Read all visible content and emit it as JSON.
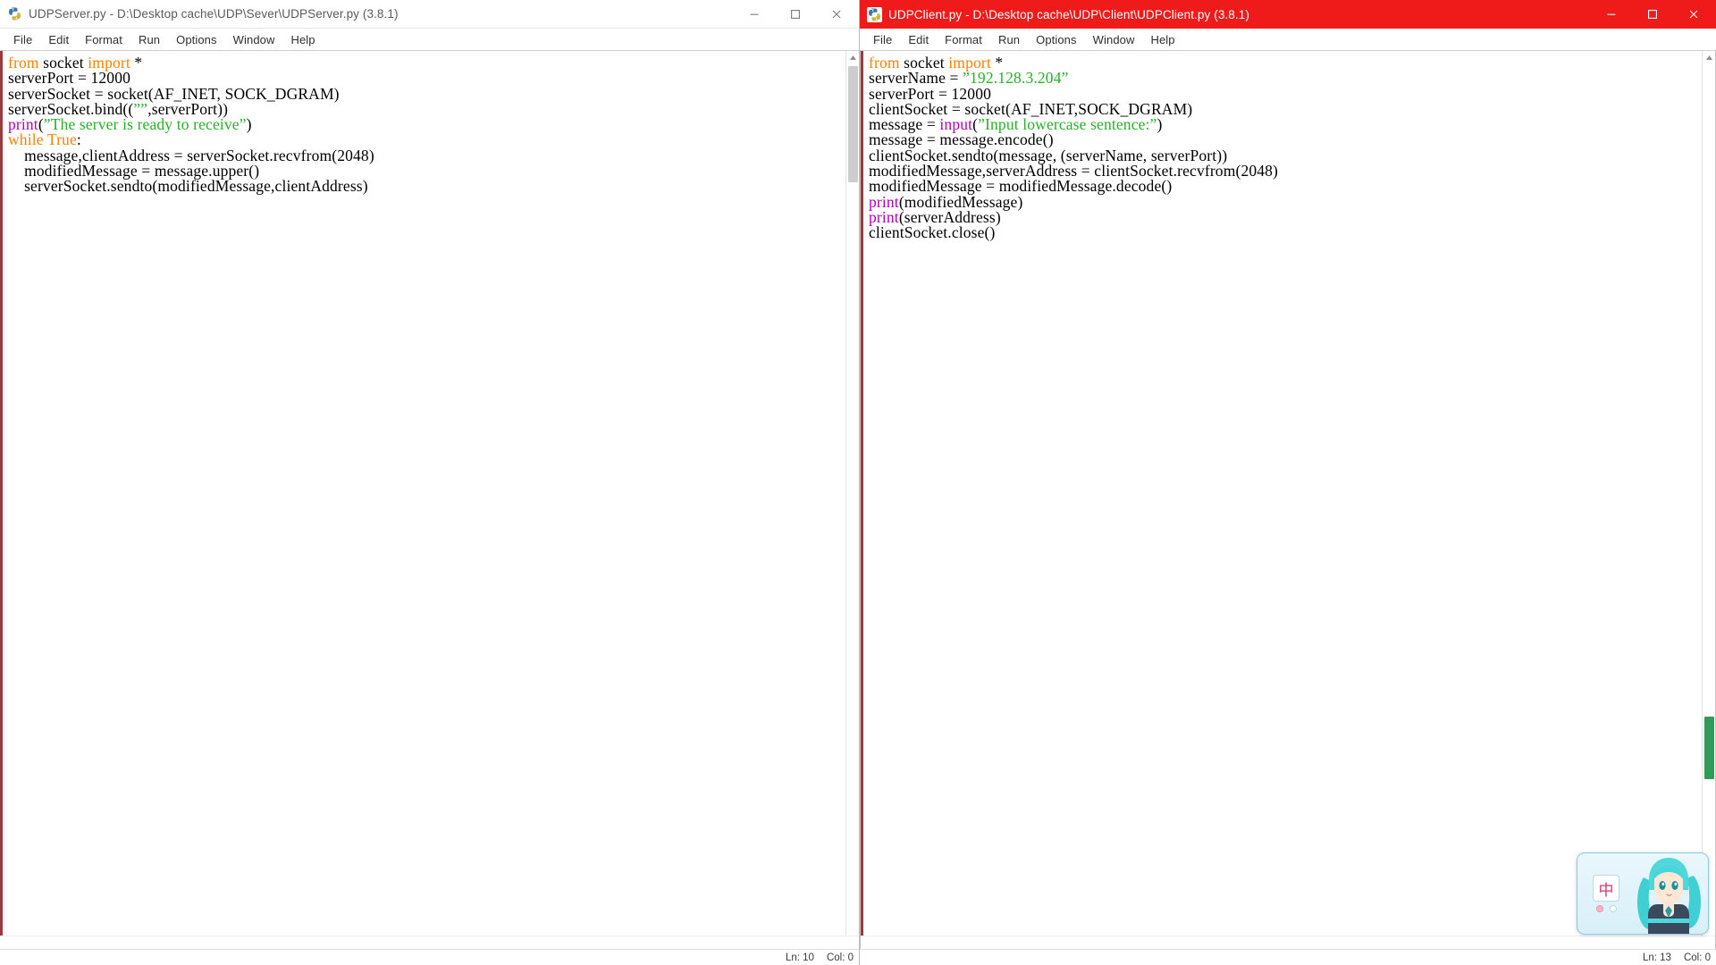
{
  "windows": {
    "server": {
      "title": "UDPServer.py - D:\\Desktop cache\\UDP\\Sever\\UDPServer.py (3.8.1)",
      "icon": "python-idle-icon",
      "active": false,
      "menu": [
        "File",
        "Edit",
        "Format",
        "Run",
        "Options",
        "Window",
        "Help"
      ],
      "controls": {
        "minimize": "minimize-icon",
        "maximize": "maximize-icon",
        "close": "close-icon"
      },
      "code": [
        [
          {
            "t": "from",
            "c": "k-keyword"
          },
          {
            "t": " socket ",
            "c": ""
          },
          {
            "t": "import",
            "c": "k-keyword"
          },
          {
            "t": " *",
            "c": ""
          }
        ],
        [
          {
            "t": "serverPort = 12000",
            "c": ""
          }
        ],
        [
          {
            "t": "serverSocket = socket(AF_INET, SOCK_DGRAM)",
            "c": ""
          }
        ],
        [
          {
            "t": "serverSocket.bind((",
            "c": ""
          },
          {
            "t": "””",
            "c": "k-string"
          },
          {
            "t": ",serverPort))",
            "c": ""
          }
        ],
        [
          {
            "t": "print",
            "c": "k-builtin"
          },
          {
            "t": "(",
            "c": ""
          },
          {
            "t": "”The server is ready to receive”",
            "c": "k-string"
          },
          {
            "t": ")",
            "c": ""
          }
        ],
        [
          {
            "t": "while",
            "c": "k-keyword"
          },
          {
            "t": " ",
            "c": ""
          },
          {
            "t": "True",
            "c": "k-keyword"
          },
          {
            "t": ":",
            "c": ""
          }
        ],
        [
          {
            "t": "    message,clientAddress = serverSocket.recvfrom(2048)",
            "c": ""
          }
        ],
        [
          {
            "t": "    modifiedMessage = message.upper()",
            "c": ""
          }
        ],
        [
          {
            "t": "    serverSocket.sendto(modifiedMessage,clientAddress)",
            "c": ""
          }
        ]
      ],
      "status": {
        "line": "Ln: 10",
        "col": "Col: 0"
      }
    },
    "client": {
      "title": "UDPClient.py - D:\\Desktop cache\\UDP\\Client\\UDPClient.py (3.8.1)",
      "icon": "python-idle-icon",
      "active": true,
      "menu": [
        "File",
        "Edit",
        "Format",
        "Run",
        "Options",
        "Window",
        "Help"
      ],
      "controls": {
        "minimize": "minimize-icon",
        "maximize": "maximize-icon",
        "close": "close-icon"
      },
      "code": [
        [
          {
            "t": "from",
            "c": "k-keyword"
          },
          {
            "t": " socket ",
            "c": ""
          },
          {
            "t": "import",
            "c": "k-keyword"
          },
          {
            "t": " *",
            "c": ""
          }
        ],
        [
          {
            "t": "serverName = ",
            "c": ""
          },
          {
            "t": "”192.128.3.204”",
            "c": "k-string"
          }
        ],
        [
          {
            "t": "serverPort = 12000",
            "c": ""
          }
        ],
        [
          {
            "t": "clientSocket = socket(AF_INET,SOCK_DGRAM)",
            "c": ""
          }
        ],
        [
          {
            "t": "message = ",
            "c": ""
          },
          {
            "t": "input",
            "c": "k-builtin"
          },
          {
            "t": "(",
            "c": ""
          },
          {
            "t": "”Input lowercase sentence:”",
            "c": "k-string"
          },
          {
            "t": ")",
            "c": ""
          }
        ],
        [
          {
            "t": "message = message.encode()",
            "c": ""
          }
        ],
        [
          {
            "t": "clientSocket.sendto(message, (serverName, serverPort))",
            "c": ""
          }
        ],
        [
          {
            "t": "modifiedMessage,serverAddress = clientSocket.recvfrom(2048)",
            "c": ""
          }
        ],
        [
          {
            "t": "modifiedMessage = modifiedMessage.decode()",
            "c": ""
          }
        ],
        [
          {
            "t": "print",
            "c": "k-builtin"
          },
          {
            "t": "(modifiedMessage)",
            "c": ""
          }
        ],
        [
          {
            "t": "print",
            "c": "k-builtin"
          },
          {
            "t": "(serverAddress)",
            "c": ""
          }
        ],
        [
          {
            "t": "clientSocket.close()",
            "c": ""
          }
        ]
      ],
      "status": {
        "line": "Ln: 13",
        "col": "Col: 0"
      }
    }
  },
  "ime": {
    "mode_label": "中",
    "mascot": "hatsune-miku-mascot"
  },
  "colors": {
    "active_titlebar": "#ef1a1a",
    "keyword": "#ff8000",
    "string": "#24b324",
    "builtin": "#b300b3",
    "editor_border": "#9a3a3a"
  }
}
